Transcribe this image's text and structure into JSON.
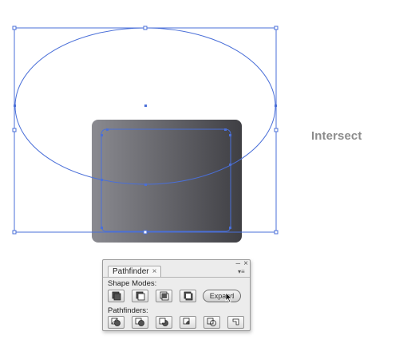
{
  "caption": "Intersect",
  "panel": {
    "tab_label": "Pathfinder",
    "tab_close": "×",
    "minimize": "–",
    "close": "×",
    "menu": "▾≡",
    "shape_modes_label": "Shape Modes:",
    "pathfinders_label": "Pathfinders:",
    "expand_label": "Expand",
    "shape_mode_buttons": [
      "unite-icon",
      "minus-front-icon",
      "intersect-icon",
      "exclude-icon"
    ],
    "pathfinder_buttons": [
      "divide-icon",
      "trim-icon",
      "merge-icon",
      "crop-icon",
      "outline-icon",
      "minus-back-icon"
    ]
  },
  "colors": {
    "selection": "#4a6fd8",
    "shape_dark": "#3f3f44",
    "shape_light": "#8a8a90",
    "caption": "#8c8c8c"
  }
}
